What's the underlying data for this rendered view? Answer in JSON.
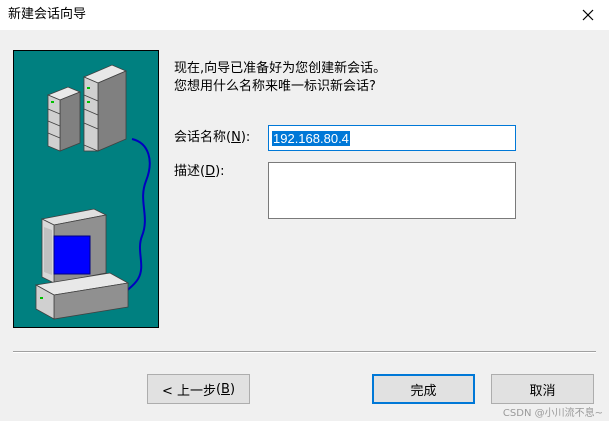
{
  "window": {
    "title": "新建会话向导",
    "close_symbol": "✕"
  },
  "intro": {
    "line1": "现在,向导已准备好为您创建新会话。",
    "line2": "您想用什么名称来唯一标识新会话?"
  },
  "form": {
    "name_label": "会话名称",
    "name_accel": "N",
    "name_value": "192.168.80.4",
    "desc_label": "描述",
    "desc_accel": "D",
    "desc_value": ""
  },
  "buttons": {
    "back_prefix": "< 上一步",
    "back_accel": "B",
    "finish_label": "完成",
    "cancel_label": "取消"
  },
  "watermark": "CSDN @小川流不息~",
  "icons": {
    "close": "close-icon",
    "illustration": "server-network-computer-illustration"
  },
  "colors": {
    "illustration_bg": "#008080",
    "accent": "#0078d7",
    "screen": "#0000ff"
  }
}
